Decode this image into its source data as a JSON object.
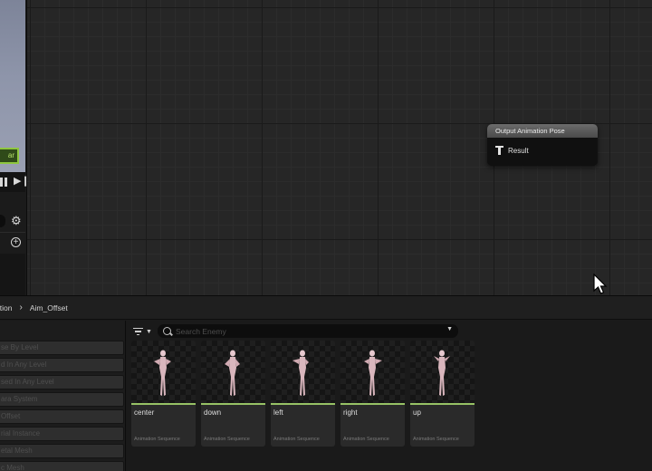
{
  "viewport": {
    "badge_text": "ar"
  },
  "graph": {
    "output_node": {
      "title": "Output Animation Pose",
      "pin_label": "Result"
    }
  },
  "content_browser": {
    "breadcrumb": [
      "mation",
      "Aim_Offset"
    ],
    "search": {
      "placeholder": "Search Enemy",
      "value": ""
    },
    "filters": [
      "se By Level",
      "d In Any Level",
      "sed In Any Level",
      "ara System",
      "Offset",
      "rial Instance",
      "etal Mesh",
      "c Mesh"
    ],
    "assets": [
      {
        "name": "center",
        "type": "Animation Sequence"
      },
      {
        "name": "down",
        "type": "Animation Sequence"
      },
      {
        "name": "left",
        "type": "Animation Sequence"
      },
      {
        "name": "right",
        "type": "Animation Sequence"
      },
      {
        "name": "up",
        "type": "Animation Sequence"
      }
    ]
  },
  "colors": {
    "asset_type_bar": "#97c265",
    "viewport_badge_border": "#8ec63f"
  },
  "icons": [
    "pause-icon",
    "step-forward-icon",
    "gear-icon",
    "add-circle-icon",
    "pose-pin-icon",
    "filter-icon",
    "search-icon",
    "chevron-down-icon",
    "mouse-cursor-icon"
  ]
}
